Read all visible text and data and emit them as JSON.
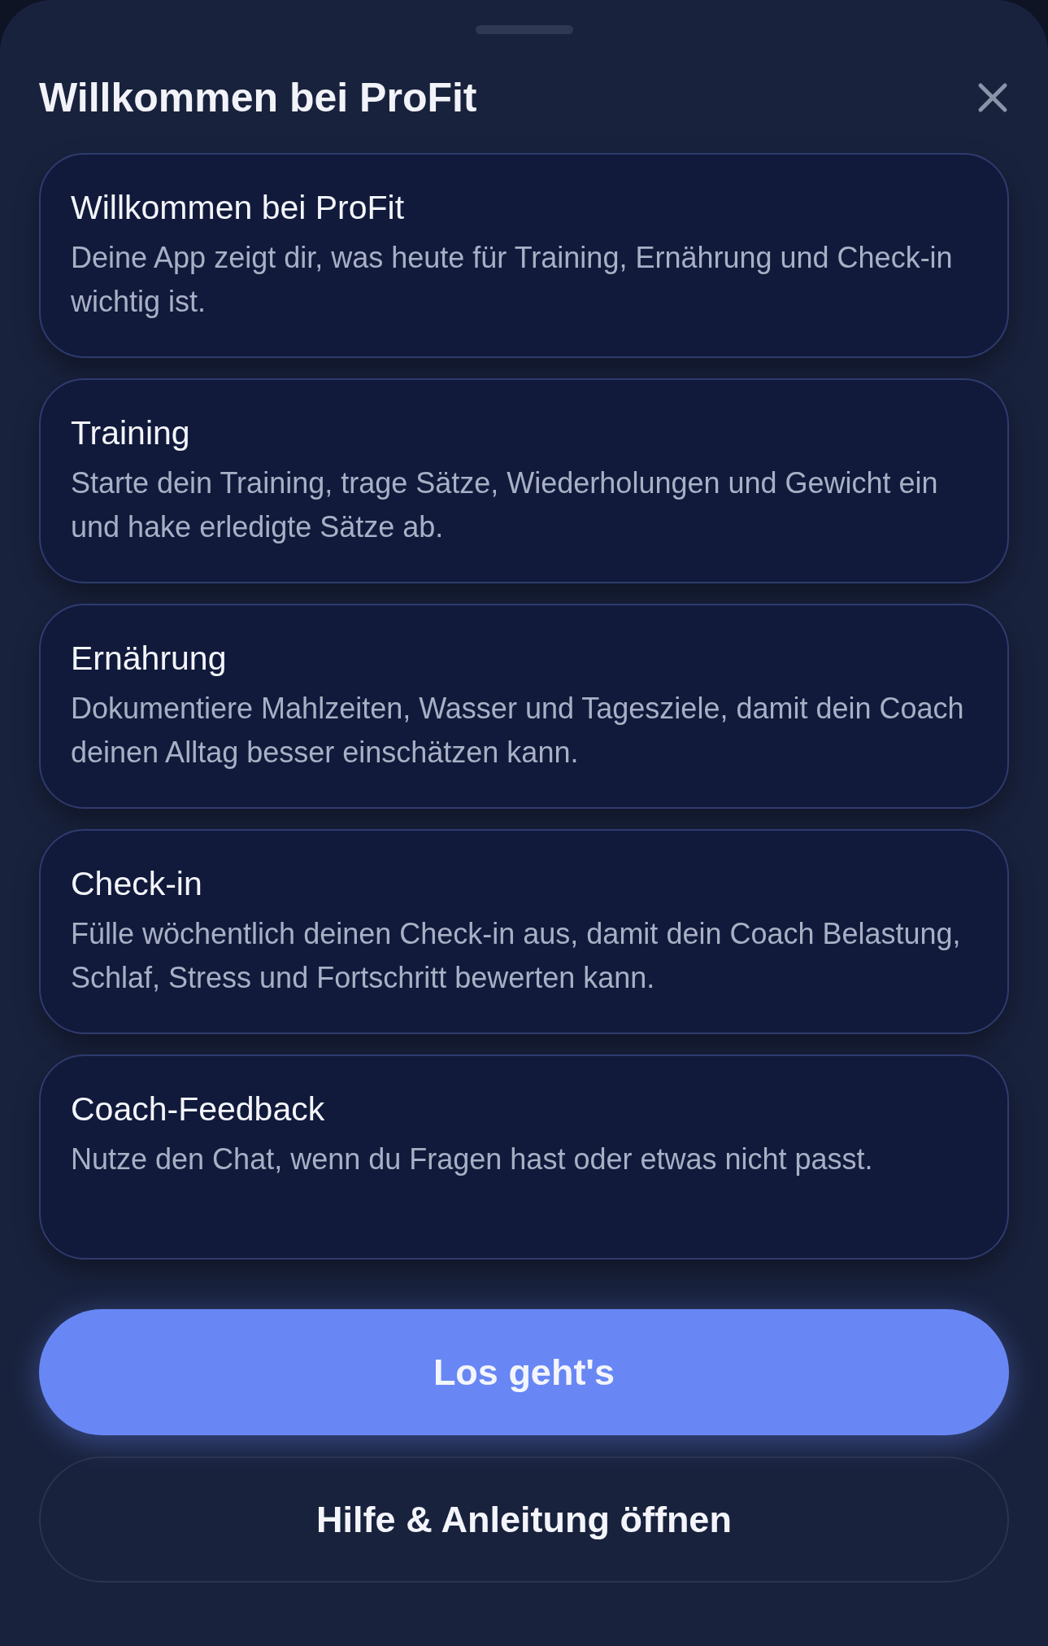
{
  "sheet": {
    "title": "Willkommen bei ProFit"
  },
  "cards": [
    {
      "title": "Willkommen bei ProFit",
      "text": "Deine App zeigt dir, was heute für Training, Ernährung und Check-in wichtig ist."
    },
    {
      "title": "Training",
      "text": "Starte dein Training, trage Sätze, Wiederholungen und Gewicht ein und hake erledigte Sätze ab."
    },
    {
      "title": "Ernährung",
      "text": "Dokumentiere Mahlzeiten, Wasser und Tagesziele, damit dein Coach deinen Alltag besser einschätzen kann."
    },
    {
      "title": "Check-in",
      "text": "Fülle wöchentlich deinen Check-in aus, damit dein Coach Belastung, Schlaf, Stress und Fortschritt bewerten kann."
    },
    {
      "title": "Coach-Feedback",
      "text": "Nutze den Chat, wenn du Fragen hast oder etwas nicht passt."
    }
  ],
  "buttons": [
    {
      "label": "Los geht's",
      "kind": "primary"
    },
    {
      "label": "Hilfe & Anleitung öffnen",
      "kind": "secondary"
    }
  ]
}
